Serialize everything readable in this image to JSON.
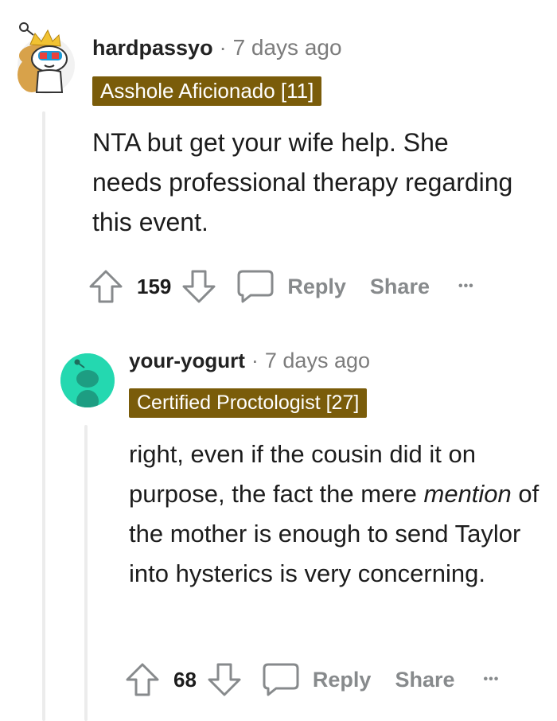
{
  "comments": [
    {
      "username": "hardpassyo",
      "separator": "·",
      "time": "7 days ago",
      "flair": "Asshole Aficionado [11]",
      "body": "NTA but get your wife help. She needs professional therapy regarding this event.",
      "votes": "159",
      "reply_label": "Reply",
      "share_label": "Share",
      "more_label": "•••"
    },
    {
      "username": "your-yogurt",
      "separator": "·",
      "time": "7 days ago",
      "flair": "Certified Proctologist [27]",
      "body_before": "right, even if the cousin did it on purpose, the fact the mere ",
      "body_emphasis": "mention",
      "body_after": " of the mother is enough to send Taylor into hysterics is very concerning.",
      "votes": "68",
      "reply_label": "Reply",
      "share_label": "Share",
      "more_label": "•••"
    }
  ],
  "icons": {
    "upvote": "arrow-up-icon",
    "downvote": "arrow-down-icon",
    "reply": "speech-bubble-icon",
    "more": "more-dots-icon"
  },
  "colors": {
    "flair_bg": "#7a5c0a",
    "avatar2_bg": "#24d8b0",
    "muted": "#878a8c"
  }
}
